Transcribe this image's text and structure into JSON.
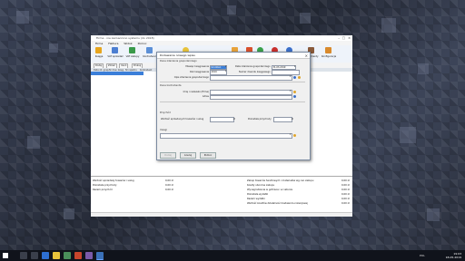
{
  "window": {
    "title": "Firma - nie zaznaczono systemu (do 2018)",
    "menu": [
      "Firma",
      "Faktura",
      "Widok",
      "Pomoc"
    ]
  },
  "toolbar": {
    "items": [
      {
        "label": "Księga",
        "icon": "book-icon",
        "color": "#e7a51d"
      },
      {
        "label": "VAT sprzedaż",
        "icon": "invoice-sale-icon",
        "color": "#4c7ed1"
      },
      {
        "label": "VAT zakupy",
        "icon": "invoice-purchase-icon",
        "color": "#3a9a4a"
      },
      {
        "label": "Kontrahenci",
        "icon": "contacts-icon",
        "color": "#5b8fd6"
      },
      {
        "label": "",
        "icon": "folder-icon",
        "color": "#e8c33b"
      },
      {
        "label": "",
        "icon": "hand-icon",
        "color": "#e8a33b"
      },
      {
        "label": "",
        "icon": "flag-icon",
        "color": "#d9512c"
      },
      {
        "label": "",
        "icon": "go-icon",
        "color": "#3aa14a"
      },
      {
        "label": "",
        "icon": "stop-icon",
        "color": "#c9302c"
      },
      {
        "label": "",
        "icon": "help-icon",
        "color": "#3b6fc9"
      },
      {
        "label": "Dokumenty",
        "icon": "documents-icon",
        "color": "#8a5a3a"
      },
      {
        "label": "Konfiguracja",
        "icon": "settings-icon",
        "color": "#d98a2c"
      }
    ],
    "secondary": [
      "Dodaj",
      "Zmień",
      "Usuń",
      "Drukuj"
    ]
  },
  "grid": {
    "columns": [
      "Data zd. gosp.",
      "Nr dow. księg.",
      "Nr rejestru",
      "Kontrahent"
    ]
  },
  "summary": {
    "left": [
      {
        "label": "Wartość sprzedaży towarów i usług",
        "value": "0,00 zł"
      },
      {
        "label": "Pozostałe przychody",
        "value": "0,00 zł"
      },
      {
        "label": "Razem przychód",
        "value": "0,00 zł"
      }
    ],
    "right": [
      {
        "label": "Zakup towarów handlowych i materiałów wg cen zakupu",
        "value": "0,00 zł"
      },
      {
        "label": "Koszty uboczne zakupu",
        "value": "0,00 zł"
      },
      {
        "label": "Wynagrodzenia w gotówce i w naturze",
        "value": "0,00 zł"
      },
      {
        "label": "Pozostałe wydatki",
        "value": "0,00 zł"
      },
      {
        "label": "Razem wydatki",
        "value": "0,00 zł"
      },
      {
        "label": "Wartość kosztów działalności badawczo-rozwojowej",
        "value": "0,00 zł"
      }
    ]
  },
  "dialog": {
    "title": "Dodawanie nowego wpisu",
    "section_event": "Dane zdarzenia gospodarczego",
    "month_label": "Miesiąc księgowania",
    "month_value": "Grudzień",
    "date_label": "Data zdarzenia gospodarczego",
    "date_value": "31-03-2019",
    "year_label": "Rok księgowania",
    "year_value": "2019",
    "docnum_label": "Numer dowodu księgowego",
    "desc_label": "Opis zdarzenia gospodarczego",
    "section_contractor": "Dane kontrahenta",
    "contractor_name_label": "Imię i nazwisko (firma)",
    "contractor_address_label": "Adres",
    "section_income": "Przychód",
    "income_sale_label": "Wartość sprzedanych towarów i usług",
    "income_sale_unit": "zł",
    "income_other_label": "Pozostałe przychody",
    "income_other_unit": "zł",
    "section_notes": "Uwagi",
    "ok_label": "Dodaj",
    "cancel_label": "Anuluj",
    "help_label": "Pomoc"
  },
  "taskbar": {
    "time": "19:03",
    "date": "18-05-2019",
    "lang": "POL"
  }
}
